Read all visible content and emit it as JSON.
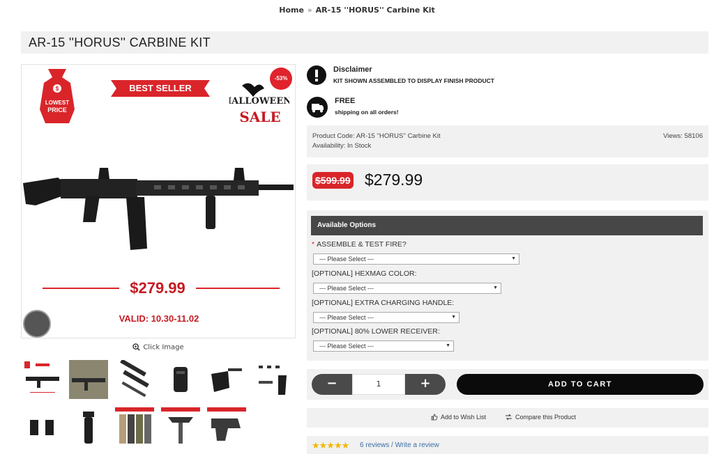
{
  "breadcrumb": {
    "home": "Home",
    "separator": "»",
    "current": "AR-15 ''HORUS'' Carbine Kit"
  },
  "product": {
    "title": "AR-15 ''HORUS'' CARBINE KIT",
    "code_line": "Product Code: AR-15 ''HORUS'' Carbine Kit",
    "availability_line": "Availability: In Stock",
    "views_line": "Views: 58106",
    "old_price": "$599.99",
    "new_price": "$279.99"
  },
  "image": {
    "tag_text_1": "LOWEST",
    "tag_text_2": "PRICE",
    "best_seller": "BEST SELLER",
    "discount": "-53%",
    "halloween_1": "HALLOWEEN",
    "halloween_2": "SALE",
    "price": "$279.99",
    "valid": "VALID: 10.30-11.02",
    "click_image": "Click Image"
  },
  "info": {
    "disclaimer_title": "Disclaimer",
    "disclaimer_text": "KIT SHOWN ASSEMBLED TO DISPLAY FINISH PRODUCT",
    "free_title": "FREE",
    "free_text": "shipping on all orders!"
  },
  "options": {
    "header": "Available Options",
    "items": [
      {
        "label": "ASSEMBLE & TEST FIRE?",
        "required": "*",
        "value": "--- Please Select ---"
      },
      {
        "label": "[OPTIONAL] HEXMAG COLOR:",
        "required": "",
        "value": "--- Please Select ---"
      },
      {
        "label": "[OPTIONAL] EXTRA CHARGING HANDLE:",
        "required": "",
        "value": "--- Please Select ---"
      },
      {
        "label": "[OPTIONAL] 80% LOWER RECEIVER:",
        "required": "",
        "value": "--- Please Select ---"
      }
    ]
  },
  "cart": {
    "minus": "−",
    "quantity": "1",
    "plus": "+",
    "add_to_cart": "ADD TO CART"
  },
  "wishlist": {
    "add": "Add to Wish List",
    "compare": "Compare this Product"
  },
  "reviews": {
    "stars": "★★★★★",
    "rating": 5,
    "count_text": "6 reviews",
    "separator": " / ",
    "write": "Write a review"
  },
  "colors": {
    "accent_red": "#d9252a",
    "dark": "#0b0b0b",
    "panel": "#f1f1f1",
    "link": "#3a6ea5",
    "star": "#f2b705"
  }
}
